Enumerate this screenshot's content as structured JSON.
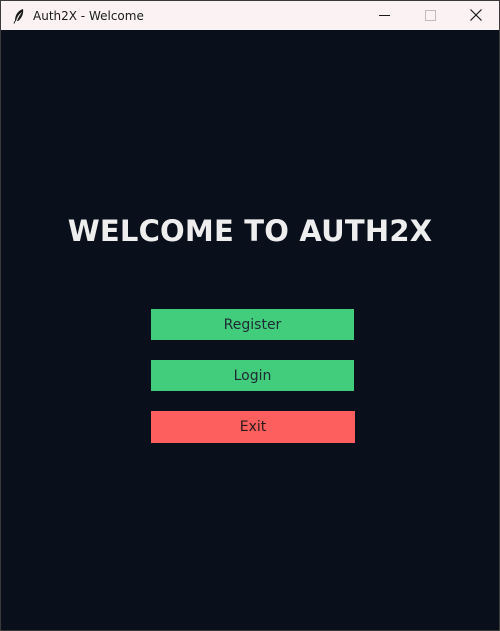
{
  "window": {
    "title": "Auth2X - Welcome",
    "icon": "feather-icon"
  },
  "controls": {
    "minimize_icon": "minimize-icon",
    "maximize_icon": "maximize-icon",
    "close_icon": "close-icon"
  },
  "main": {
    "heading": "WELCOME TO AUTH2X",
    "buttons": {
      "register": "Register",
      "login": "Login",
      "exit": "Exit"
    }
  },
  "colors": {
    "background": "#0a0f1c",
    "titlebar": "#fbf3f3",
    "primary_button": "#41cd7c",
    "danger_button": "#fd5e5e",
    "heading_text": "#eeeeee"
  }
}
